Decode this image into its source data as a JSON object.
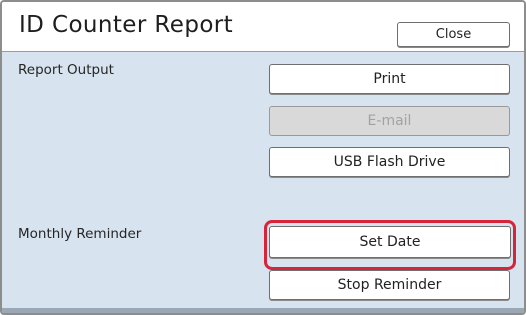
{
  "dialog": {
    "title": "ID Counter Report",
    "close_label": "Close"
  },
  "report_output": {
    "label": "Report Output",
    "print_label": "Print",
    "email_label": "E-mail",
    "email_enabled": false,
    "usb_label": "USB Flash Drive"
  },
  "monthly_reminder": {
    "label": "Monthly Reminder",
    "set_date_label": "Set Date",
    "set_date_highlighted": true,
    "stop_label": "Stop Reminder"
  },
  "colors": {
    "background": "#d7e3ef",
    "highlight": "#d6253a",
    "disabled_button": "#d9d9d9"
  }
}
